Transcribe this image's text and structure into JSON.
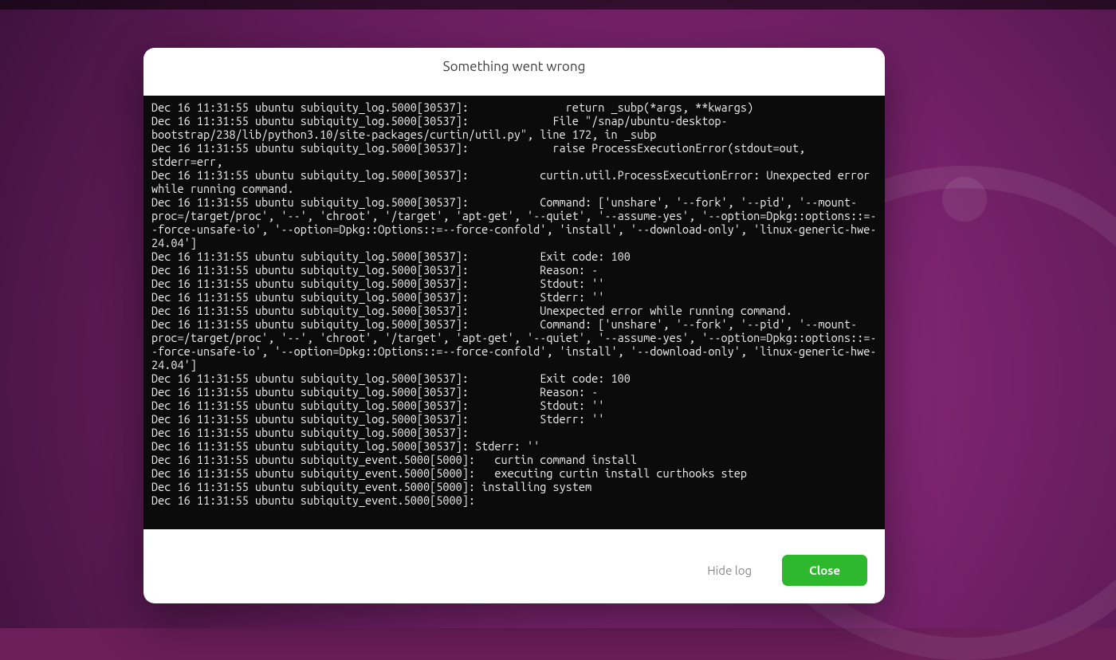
{
  "dialog": {
    "title": "Something went wrong",
    "hide_log_label": "Hide log",
    "close_label": "Close"
  },
  "log": {
    "lines": [
      "Dec 16 11:31:55 ubuntu subiquity_log.5000[30537]:               return _subp(*args, **kwargs)",
      "Dec 16 11:31:55 ubuntu subiquity_log.5000[30537]:             File \"/snap/ubuntu-desktop-bootstrap/238/lib/python3.10/site-packages/curtin/util.py\", line 172, in _subp",
      "Dec 16 11:31:55 ubuntu subiquity_log.5000[30537]:             raise ProcessExecutionError(stdout=out, stderr=err,",
      "Dec 16 11:31:55 ubuntu subiquity_log.5000[30537]:           curtin.util.ProcessExecutionError: Unexpected error while running command.",
      "Dec 16 11:31:55 ubuntu subiquity_log.5000[30537]:           Command: ['unshare', '--fork', '--pid', '--mount-proc=/target/proc', '--', 'chroot', '/target', 'apt-get', '--quiet', '--assume-yes', '--option=Dpkg::options::=--force-unsafe-io', '--option=Dpkg::Options::=--force-confold', 'install', '--download-only', 'linux-generic-hwe-24.04']",
      "Dec 16 11:31:55 ubuntu subiquity_log.5000[30537]:           Exit code: 100",
      "Dec 16 11:31:55 ubuntu subiquity_log.5000[30537]:           Reason: -",
      "Dec 16 11:31:55 ubuntu subiquity_log.5000[30537]:           Stdout: ''",
      "Dec 16 11:31:55 ubuntu subiquity_log.5000[30537]:           Stderr: ''",
      "Dec 16 11:31:55 ubuntu subiquity_log.5000[30537]:           Unexpected error while running command.",
      "Dec 16 11:31:55 ubuntu subiquity_log.5000[30537]:           Command: ['unshare', '--fork', '--pid', '--mount-proc=/target/proc', '--', 'chroot', '/target', 'apt-get', '--quiet', '--assume-yes', '--option=Dpkg::options::=--force-unsafe-io', '--option=Dpkg::Options::=--force-confold', 'install', '--download-only', 'linux-generic-hwe-24.04']",
      "Dec 16 11:31:55 ubuntu subiquity_log.5000[30537]:           Exit code: 100",
      "Dec 16 11:31:55 ubuntu subiquity_log.5000[30537]:           Reason: -",
      "Dec 16 11:31:55 ubuntu subiquity_log.5000[30537]:           Stdout: ''",
      "Dec 16 11:31:55 ubuntu subiquity_log.5000[30537]:           Stderr: ''",
      "Dec 16 11:31:55 ubuntu subiquity_log.5000[30537]:",
      "Dec 16 11:31:55 ubuntu subiquity_log.5000[30537]: Stderr: ''",
      "Dec 16 11:31:55 ubuntu subiquity_event.5000[5000]:   curtin command install",
      "Dec 16 11:31:55 ubuntu subiquity_event.5000[5000]:   executing curtin install curthooks step",
      "Dec 16 11:31:55 ubuntu subiquity_event.5000[5000]: installing system",
      "Dec 16 11:31:55 ubuntu subiquity_event.5000[5000]:"
    ]
  }
}
